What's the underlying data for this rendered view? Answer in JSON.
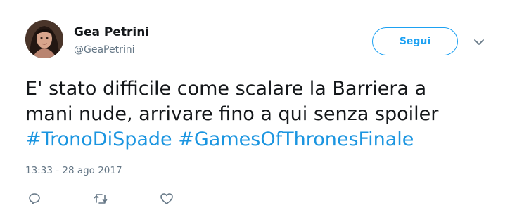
{
  "user": {
    "name": "Gea Petrini",
    "handle": "@GeaPetrini"
  },
  "follow_button": {
    "label": "Segui"
  },
  "tweet": {
    "text_line1": "E' stato difficile come scalare la Barriera a",
    "text_line2": "mani nude, arrivare fino a qui senza spoiler",
    "hashtags": [
      "#TronoDiSpade",
      "#GamesOfThronesFinale"
    ],
    "timestamp": "13:33 - 28 ago 2017"
  },
  "actions": {
    "icons": [
      "reply-icon",
      "retweet-icon",
      "like-icon"
    ]
  },
  "colors": {
    "accent": "#1da1f2",
    "hashtag": "#1b95e0",
    "secondary_text": "#657786",
    "primary_text": "#14171a"
  }
}
